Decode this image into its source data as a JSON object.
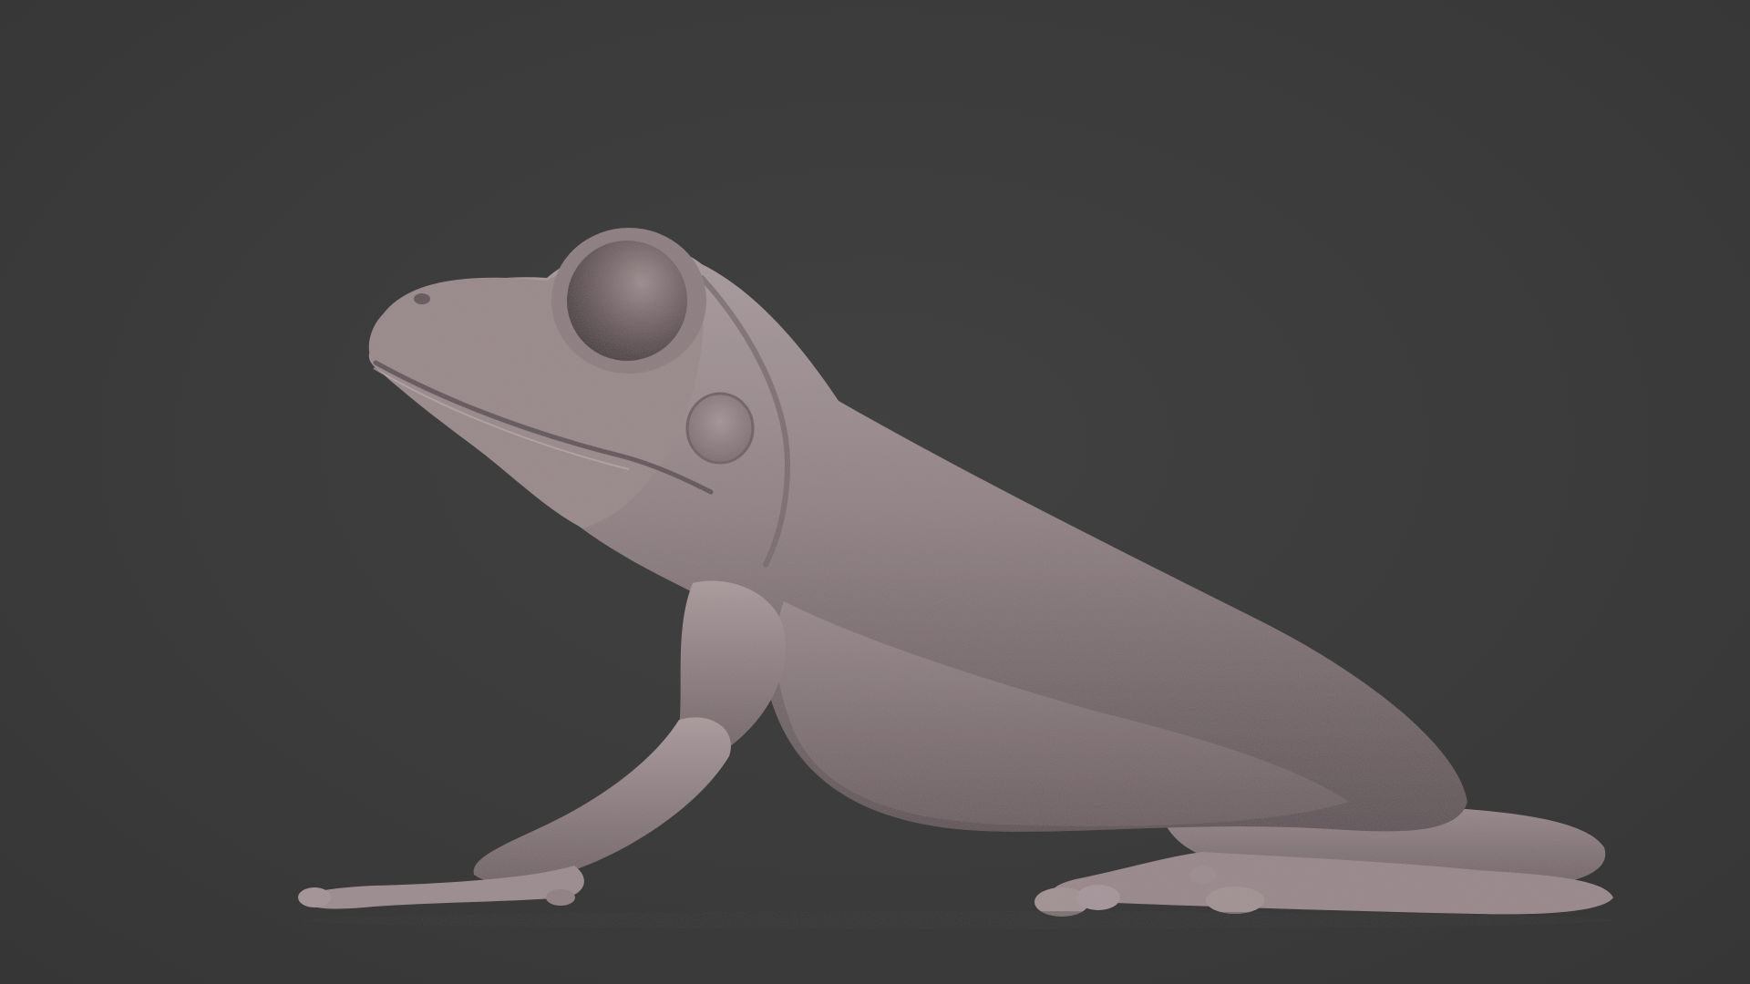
{
  "scene": {
    "subject": "",
    "background_color": "#3c3c3c",
    "material_color": "#8a7a7b",
    "material_highlight": "#b3a4a7",
    "material_shadow": "#4e4346",
    "eye_color": "#6a5a5d"
  }
}
